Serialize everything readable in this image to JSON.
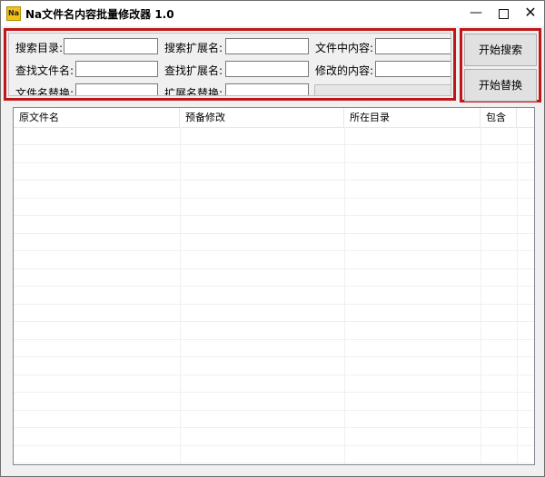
{
  "window": {
    "title": "Na文件名内容批量修改器 1.0",
    "icon_text": "Na",
    "controls": {
      "minimize": "—",
      "close": "✕"
    }
  },
  "search_panel": {
    "row1": [
      {
        "label": "搜索目录:",
        "value": ""
      },
      {
        "label": "搜索扩展名:",
        "value": ""
      },
      {
        "label": "文件中内容:",
        "value": ""
      }
    ],
    "row2": [
      {
        "label": "查找文件名:",
        "value": ""
      },
      {
        "label": "查找扩展名:",
        "value": ""
      },
      {
        "label": "修改的内容:",
        "value": ""
      }
    ],
    "row3": [
      {
        "label": "文件名替换:",
        "value": ""
      },
      {
        "label": "扩展名替换:",
        "value": ""
      }
    ]
  },
  "actions": {
    "start_search": "开始搜索",
    "start_replace": "开始替换"
  },
  "table": {
    "columns": [
      "原文件名",
      "预备修改",
      "所在目录",
      "包含"
    ]
  },
  "colors": {
    "highlight_border": "#c01616",
    "window_bg": "#f0f0f0"
  }
}
